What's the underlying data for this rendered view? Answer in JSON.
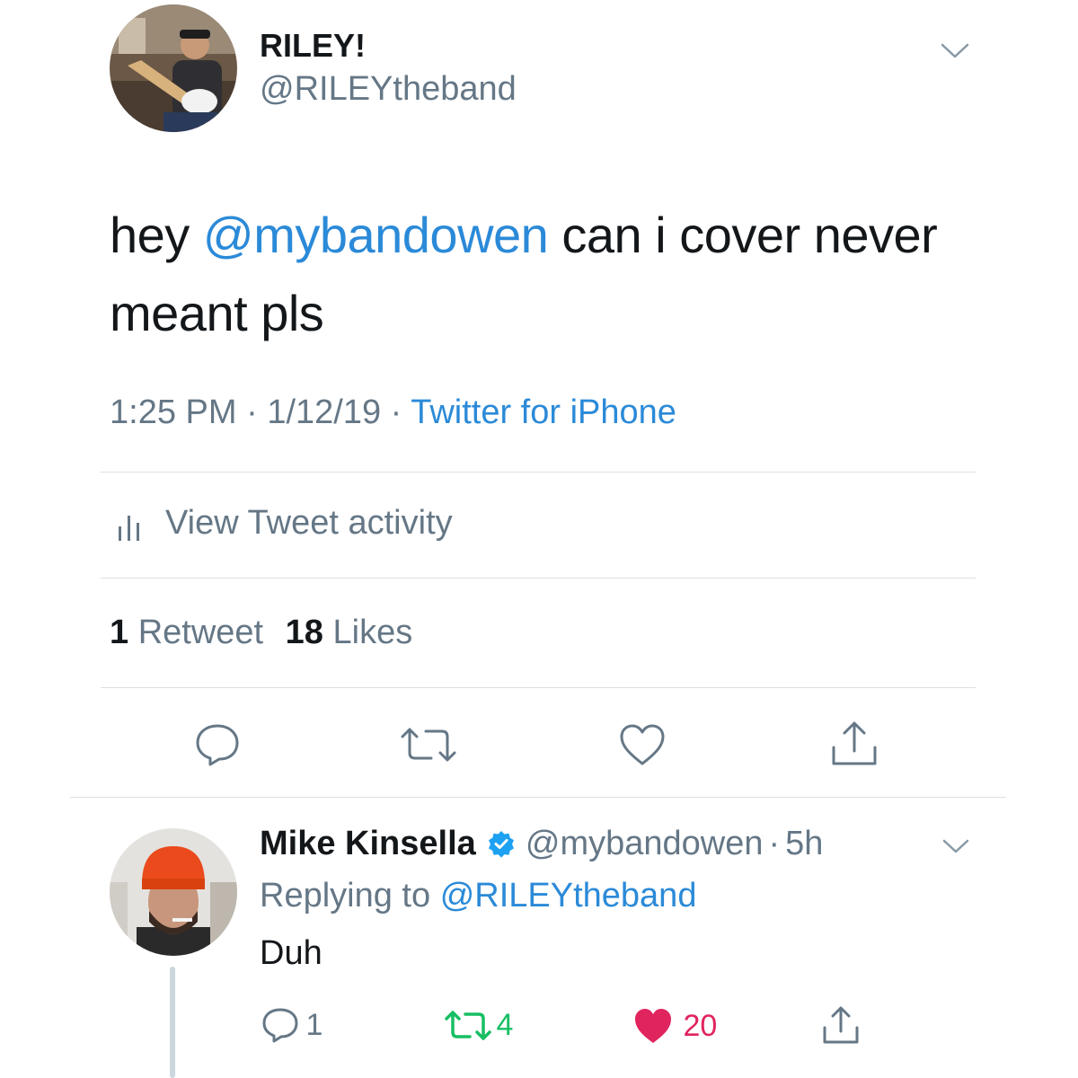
{
  "tweet": {
    "author": {
      "display_name": "RILEY!",
      "handle": "@RILEYtheband"
    },
    "text_before": "hey ",
    "mention": "@mybandowen",
    "text_after": " can i cover never meant pls",
    "time": "1:25 PM",
    "date": "1/12/19",
    "source": "Twitter for iPhone",
    "dot": "·",
    "view_activity": "View Tweet activity",
    "stats": {
      "retweets_count": "1",
      "retweets_label": "Retweet",
      "likes_count": "18",
      "likes_label": "Likes"
    }
  },
  "reply": {
    "author": {
      "display_name": "Mike Kinsella",
      "handle": "@mybandowen"
    },
    "time_ago": "5h",
    "dot": "·",
    "replying_to_label": "Replying to",
    "replying_to_handle": "@RILEYtheband",
    "text": "Duh",
    "actions": {
      "replies": "1",
      "retweets": "4",
      "likes": "20"
    }
  },
  "colors": {
    "link_blue": "#2b8ad8",
    "muted_gray": "#657786",
    "retweet_green": "#17bf63",
    "like_red": "#e0245e",
    "verified_blue": "#1da1f2"
  },
  "icons": {
    "menu": "chevron-down-icon",
    "activity": "bar-chart-icon",
    "reply": "speech-bubble-icon",
    "retweet": "retweet-icon",
    "like": "heart-icon",
    "share": "share-icon",
    "verified": "verified-badge-icon"
  }
}
